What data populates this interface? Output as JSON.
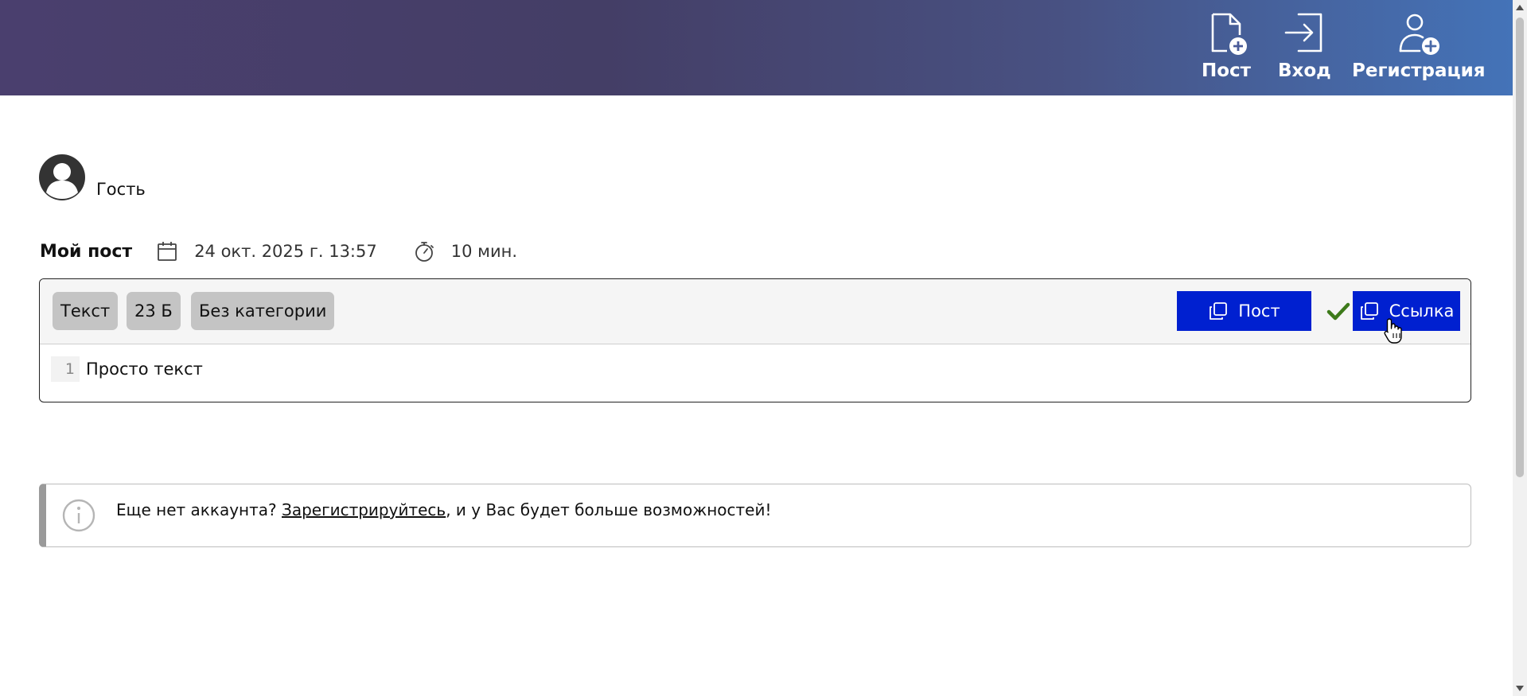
{
  "header": {
    "nav": [
      {
        "label": "Пост",
        "icon": "file-plus-icon"
      },
      {
        "label": "Вход",
        "icon": "login-icon"
      },
      {
        "label": "Регистрация",
        "icon": "user-plus-icon"
      }
    ]
  },
  "user": {
    "name": "Гость",
    "icon": "user-avatar-icon"
  },
  "post": {
    "title": "Мой пост",
    "date": "24 окт. 2025 г. 13:57",
    "expires": "10 мин.",
    "badges": [
      "Текст",
      "23 Б",
      "Без категории"
    ],
    "copy_post_label": "Пост",
    "copy_link_label": "Ссылка",
    "lines": [
      {
        "number": "1",
        "text": "Просто текст"
      }
    ]
  },
  "info": {
    "prefix": "Еще нет аккаунта? ",
    "link": "Зарегистрируйтесь",
    "suffix": ", и у Вас будет больше возможностей!"
  },
  "colors": {
    "button_bg": "#0020d0",
    "check": "#3d7a1a",
    "header_start": "#4a3f6e",
    "header_end": "#4473b8"
  }
}
